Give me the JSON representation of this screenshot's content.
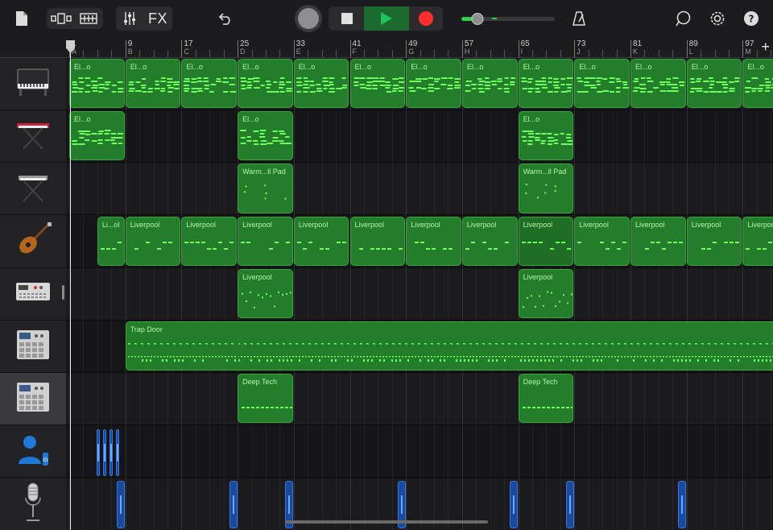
{
  "toolbar": {
    "fx_label": "FX",
    "icons": [
      "my-songs-icon",
      "browser-view-icon",
      "tracks-view-icon",
      "mixer-icon",
      "undo-icon",
      "record-enable-icon",
      "stop-icon",
      "play-icon",
      "record-icon",
      "master-volume-icon",
      "metronome-icon",
      "loop-browser-icon",
      "settings-icon",
      "help-icon"
    ],
    "volume_level": 0.12,
    "colors": {
      "play_bg": "#1d6a2f",
      "play_icon": "#22c35a",
      "record": "#ff2d2d",
      "volume_accent": "#35d04a"
    }
  },
  "ruler": {
    "bars": [
      {
        "num": "1",
        "letter": "A"
      },
      {
        "num": "9",
        "letter": "B"
      },
      {
        "num": "17",
        "letter": "C"
      },
      {
        "num": "25",
        "letter": "D"
      },
      {
        "num": "33",
        "letter": "E"
      },
      {
        "num": "41",
        "letter": "F"
      },
      {
        "num": "49",
        "letter": "G"
      },
      {
        "num": "57",
        "letter": "H"
      },
      {
        "num": "65",
        "letter": "I"
      },
      {
        "num": "73",
        "letter": "J"
      },
      {
        "num": "81",
        "letter": "K"
      },
      {
        "num": "89",
        "letter": "L"
      },
      {
        "num": "97",
        "letter": "M"
      }
    ],
    "add_section_label": "+"
  },
  "tracks": [
    {
      "name": "piano",
      "icon": "upright-piano-icon",
      "selected": false
    },
    {
      "name": "synth-keys",
      "icon": "red-keyboard-icon",
      "selected": false
    },
    {
      "name": "pad-keys",
      "icon": "keyboard-stand-icon",
      "selected": false
    },
    {
      "name": "bass",
      "icon": "bass-guitar-icon",
      "selected": false
    },
    {
      "name": "drum-machine",
      "icon": "drum-machine-icon",
      "selected": false
    },
    {
      "name": "beat-sequencer-1",
      "icon": "beat-sequencer-icon",
      "selected": false
    },
    {
      "name": "beat-sequencer-2",
      "icon": "beat-sequencer-icon",
      "selected": true
    },
    {
      "name": "vocal",
      "icon": "person-voice-icon",
      "selected": false
    },
    {
      "name": "microphone",
      "icon": "microphone-icon",
      "selected": false
    }
  ],
  "regions": [
    {
      "track": 0,
      "label": "El...o",
      "section": 0
    },
    {
      "track": 0,
      "label": "El...o",
      "section": 1
    },
    {
      "track": 0,
      "label": "El...o",
      "section": 2
    },
    {
      "track": 0,
      "label": "El...o",
      "section": 3
    },
    {
      "track": 0,
      "label": "El...o",
      "section": 4
    },
    {
      "track": 0,
      "label": "El...o",
      "section": 5
    },
    {
      "track": 0,
      "label": "El...o",
      "section": 6
    },
    {
      "track": 0,
      "label": "El...o",
      "section": 7
    },
    {
      "track": 0,
      "label": "El...o",
      "section": 8
    },
    {
      "track": 0,
      "label": "El...o",
      "section": 9
    },
    {
      "track": 0,
      "label": "El...o",
      "section": 10
    },
    {
      "track": 0,
      "label": "El...o",
      "section": 11
    },
    {
      "track": 0,
      "label": "El...o",
      "section": 12
    },
    {
      "track": 1,
      "label": "El...o",
      "section": 0
    },
    {
      "track": 1,
      "label": "El...o",
      "section": 3
    },
    {
      "track": 1,
      "label": "El...o",
      "section": 8
    },
    {
      "track": 2,
      "label": "Warm...ll Pad",
      "section": 3
    },
    {
      "track": 2,
      "label": "Warm...ll Pad",
      "section": 8
    },
    {
      "track": 3,
      "label": "Li...ol",
      "section": 0.5
    },
    {
      "track": 3,
      "label": "Liverpool",
      "section": 1
    },
    {
      "track": 3,
      "label": "Liverpool",
      "section": 2
    },
    {
      "track": 3,
      "label": "Liverpool",
      "section": 3
    },
    {
      "track": 3,
      "label": "Liverpool",
      "section": 4
    },
    {
      "track": 3,
      "label": "Liverpool",
      "section": 5
    },
    {
      "track": 3,
      "label": "Liverpool",
      "section": 6
    },
    {
      "track": 3,
      "label": "Liverpool",
      "section": 7
    },
    {
      "track": 3,
      "label": "Liverpool",
      "section": 8
    },
    {
      "track": 3,
      "label": "Liverpool",
      "section": 9
    },
    {
      "track": 3,
      "label": "Liverpool",
      "section": 10
    },
    {
      "track": 3,
      "label": "Liverpool",
      "section": 11
    },
    {
      "track": 3,
      "label": "Liverpool",
      "section": 12
    },
    {
      "track": 4,
      "label": "Liverpool",
      "section": 3
    },
    {
      "track": 4,
      "label": "Liverpool",
      "section": 8
    },
    {
      "track": 5,
      "label": "Trap Door",
      "section": 1
    },
    {
      "track": 6,
      "label": "Deep Tech",
      "section": 3
    },
    {
      "track": 6,
      "label": "Deep Tech",
      "section": 8
    }
  ]
}
